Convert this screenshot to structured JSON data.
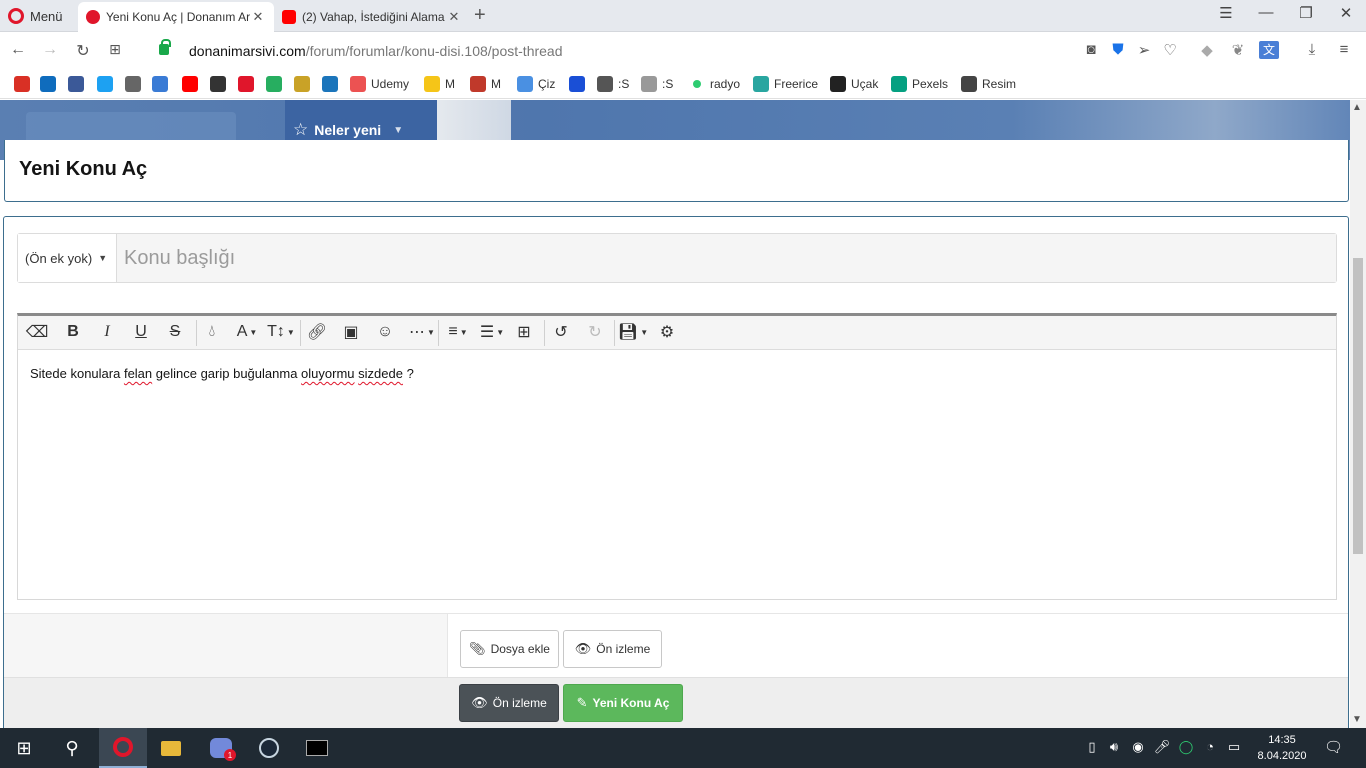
{
  "browser": {
    "menu_label": "Menü",
    "tabs": [
      {
        "title": "Yeni Konu Aç | Donanım Ar",
        "active": true,
        "icon": "donanim-favicon"
      },
      {
        "title": "(2) Vahap, İstediğini Alama",
        "active": false,
        "icon": "youtube-favicon"
      }
    ],
    "url_host": "donanimarsivi.com",
    "url_path": "/forum/forumlar/konu-disi.108/post-thread",
    "bookmarks": [
      {
        "label": "",
        "icon": "gmail-icon",
        "color": "#d93025"
      },
      {
        "label": "",
        "icon": "outlook-icon",
        "color": "#0f6cbd"
      },
      {
        "label": "",
        "icon": "facebook-icon",
        "color": "#3b5998"
      },
      {
        "label": "",
        "icon": "twitter-icon",
        "color": "#1da1f2"
      },
      {
        "label": "",
        "icon": "hat-icon",
        "color": "#666666"
      },
      {
        "label": "",
        "icon": "kablo-icon",
        "color": "#3a7bd5"
      },
      {
        "label": "",
        "icon": "youtube-icon",
        "color": "#ff0000"
      },
      {
        "label": "",
        "icon": "wolf-icon",
        "color": "#333333"
      },
      {
        "label": "",
        "icon": "donanim-icon",
        "color": "#e0162b"
      },
      {
        "label": "",
        "icon": "plus-icon",
        "color": "#27ae60"
      },
      {
        "label": "",
        "icon": "bee-icon",
        "color": "#c9a227"
      },
      {
        "label": "",
        "icon": "ih-icon",
        "color": "#1b75bb"
      },
      {
        "label": "Udemy",
        "icon": "udemy-icon",
        "color": "#ec5252"
      },
      {
        "label": "M",
        "icon": "m-yellow-icon",
        "color": "#f5c518"
      },
      {
        "label": "M",
        "icon": "m-red-icon",
        "color": "#c0392b"
      },
      {
        "label": "Çiz",
        "icon": "ciz-icon",
        "color": "#4a90e2"
      },
      {
        "label": "",
        "icon": "fm-icon",
        "color": "#1a4fd6"
      },
      {
        "label": ":S",
        "icon": "doc-icon",
        "color": "#555555"
      },
      {
        "label": ":S",
        "icon": "circle-icon",
        "color": "#999999"
      },
      {
        "label": "radyo",
        "icon": "radio-dot-icon",
        "color": "#2ecc71"
      },
      {
        "label": "Freerice",
        "icon": "freerice-icon",
        "color": "#29a6a0"
      },
      {
        "label": "Uçak",
        "icon": "plane-icon",
        "color": "#222222"
      },
      {
        "label": "Pexels",
        "icon": "pexels-icon",
        "color": "#05a081"
      },
      {
        "label": "Resim",
        "icon": "resim-icon",
        "color": "#444444"
      }
    ]
  },
  "site": {
    "nav_item": "Neler yeni",
    "page_title": "Yeni Konu Aç"
  },
  "form": {
    "prefix": "(Ön ek yok)",
    "title_placeholder": "Konu başlığı",
    "editor_text_parts": [
      {
        "text": "Sitede konulara ",
        "spell": false
      },
      {
        "text": "felan",
        "spell": true
      },
      {
        "text": " gelince garip buğulanma ",
        "spell": false
      },
      {
        "text": "oluyormu",
        "spell": true
      },
      {
        "text": " ",
        "spell": false
      },
      {
        "text": "sizdede",
        "spell": true
      },
      {
        "text": " ?",
        "spell": false
      }
    ],
    "attach_label": "Dosya ekle",
    "preview_label": "Ön izleme",
    "submit_preview_label": "Ön izleme",
    "submit_label": "Yeni Konu Aç"
  },
  "taskbar": {
    "time": "14:35",
    "date": "8.04.2020",
    "discord_badge": "1"
  }
}
